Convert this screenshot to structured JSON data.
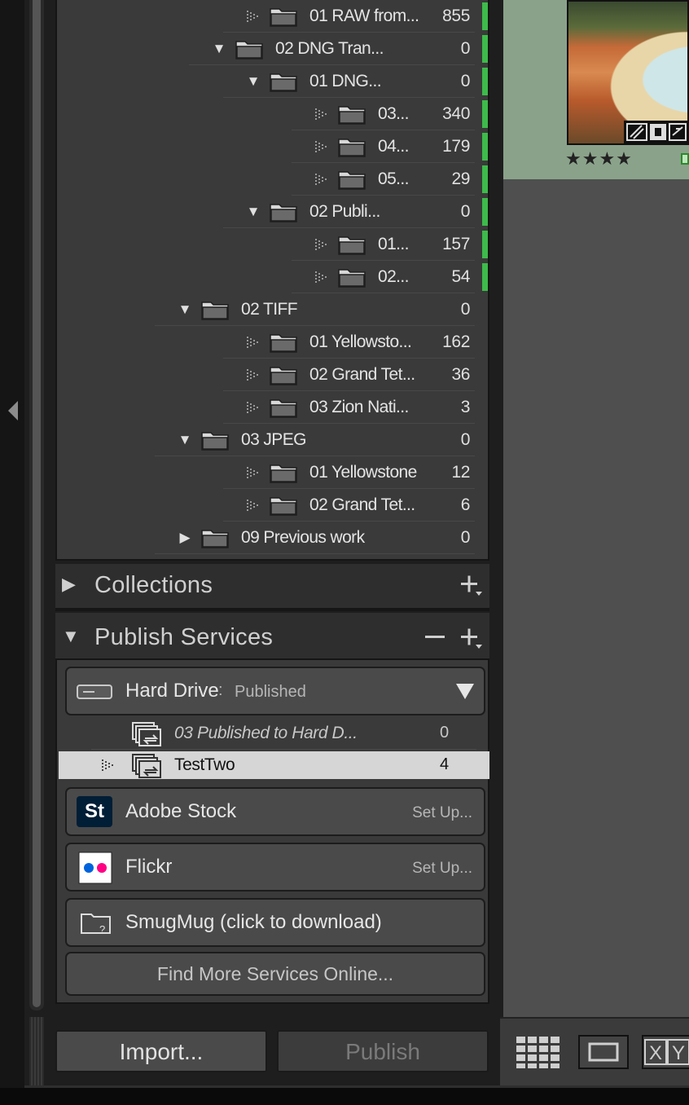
{
  "folders": [
    {
      "label": "01 RAW from...",
      "count": "855",
      "indent": 2,
      "type": "dots",
      "green": true
    },
    {
      "label": "02 DNG Tran...",
      "count": "0",
      "indent": 2,
      "type": "down",
      "green": true
    },
    {
      "label": "01 DNG...",
      "count": "0",
      "indent": 3,
      "type": "down",
      "green": true
    },
    {
      "label": "03...",
      "count": "340",
      "indent": 4,
      "type": "dots",
      "green": true
    },
    {
      "label": "04...",
      "count": "179",
      "indent": 4,
      "type": "dots",
      "green": true
    },
    {
      "label": "05...",
      "count": "29",
      "indent": 4,
      "type": "dots",
      "green": true
    },
    {
      "label": "02 Publi...",
      "count": "0",
      "indent": 3,
      "type": "down",
      "green": true
    },
    {
      "label": "01...",
      "count": "157",
      "indent": 4,
      "type": "dots",
      "green": true
    },
    {
      "label": "02...",
      "count": "54",
      "indent": 4,
      "type": "dots",
      "green": true
    },
    {
      "label": "02 TIFF",
      "count": "0",
      "indent": 1,
      "type": "down",
      "green": false
    },
    {
      "label": "01 Yellowsto...",
      "count": "162",
      "indent": 2,
      "type": "dots",
      "green": false
    },
    {
      "label": "02 Grand Tet...",
      "count": "36",
      "indent": 2,
      "type": "dots",
      "green": false
    },
    {
      "label": "03 Zion Nati...",
      "count": "3",
      "indent": 2,
      "type": "dots",
      "green": false
    },
    {
      "label": "03 JPEG",
      "count": "0",
      "indent": 1,
      "type": "down",
      "green": false
    },
    {
      "label": "01 Yellowstone",
      "count": "12",
      "indent": 2,
      "type": "dots",
      "green": false
    },
    {
      "label": "02 Grand Tet...",
      "count": "6",
      "indent": 2,
      "type": "dots",
      "green": false
    },
    {
      "label": "09 Previous work",
      "count": "0",
      "indent": 1,
      "type": "right",
      "green": false
    }
  ],
  "collections": {
    "title": "Collections",
    "plus": "+"
  },
  "publish": {
    "title": "Publish Services",
    "minus": "−",
    "plus": "+",
    "hard_drive": {
      "name": "Hard Drive",
      "sep": ":",
      "status": "Published"
    },
    "rows": [
      {
        "label": "03 Published to Hard D...",
        "count": "0"
      },
      {
        "label": "TestTwo",
        "count": "4"
      }
    ],
    "adobe_stock": {
      "logo": "St",
      "name": "Adobe Stock",
      "setup": "Set Up..."
    },
    "flickr": {
      "name": "Flickr",
      "setup": "Set Up..."
    },
    "smugmug": {
      "name": "SmugMug (click to download)"
    },
    "find_more": "Find More Services Online..."
  },
  "buttons": {
    "import": "Import...",
    "publish": "Publish"
  },
  "thumbnail": {
    "stars": "★★★★",
    "rating": 4
  },
  "toolbar": {
    "compare_label": "X Y"
  },
  "colors": {
    "green_label": "#3dbb4a",
    "selected_row": "#d6d6d6",
    "panel": "#3a3a3a"
  }
}
